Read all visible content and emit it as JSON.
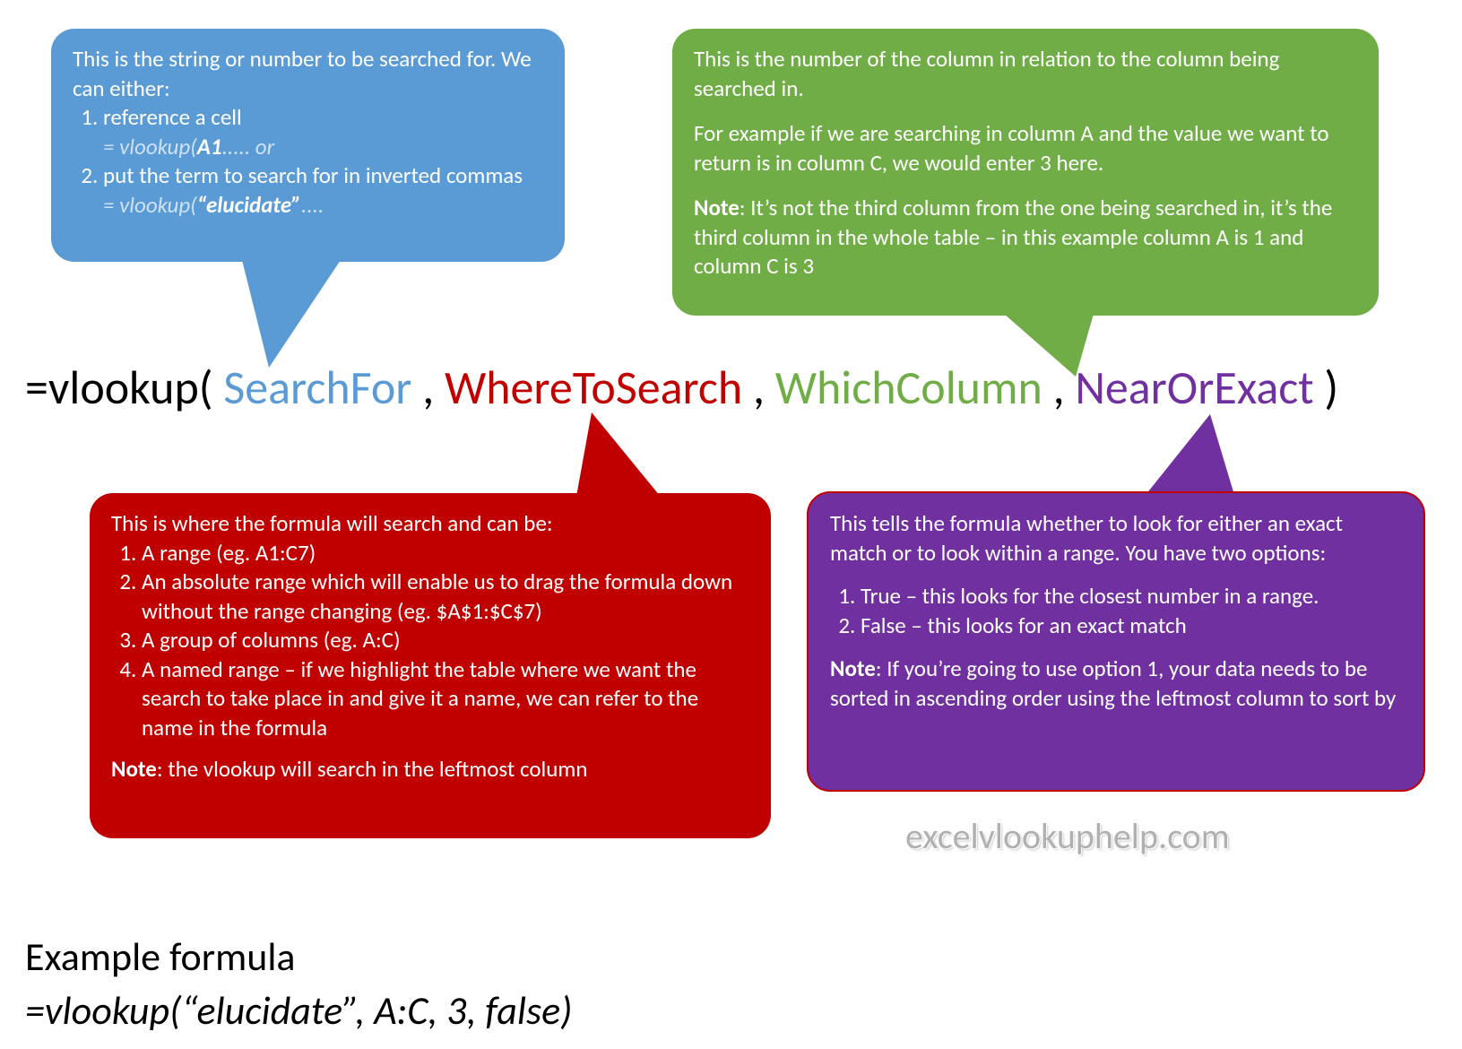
{
  "formula": {
    "prefix": "=vlookup(",
    "arg1": "SearchFor",
    "arg2": "WhereToSearch",
    "arg3": "WhichColumn",
    "arg4": "NearOrExact",
    "sep1": ",",
    "sep2": ",",
    "sep3": ",",
    "suffix": ")"
  },
  "callouts": {
    "searchFor": {
      "intro": "This is the string or number to be searched for. We can either:",
      "opt1": "reference a cell",
      "opt1_code_pre": "= vlookup(",
      "opt1_code_em": "A1",
      "opt1_code_post": "..... or",
      "opt2": "put the term to search for in inverted commas",
      "opt2_code_pre": "= vlookup(",
      "opt2_code_em": "“elucidate”",
      "opt2_code_post": "...."
    },
    "whichColumn": {
      "p1": "This is the number of the column in relation to the column being searched in.",
      "p2": "For example if we are searching in column A and the value we want to return is in column C, we would enter 3 here.",
      "note_label": "Note",
      "note": ": It’s not the third column from the one being searched in, it’s the third column in the whole table – in this example column A is 1 and column C is 3"
    },
    "whereToSearch": {
      "intro": "This is where the formula will search and can be:",
      "o1": "A range (eg. A1:C7)",
      "o2": "An absolute range which will enable us to drag the formula down without the range changing (eg. $A$1:$C$7)",
      "o3": "A group of columns (eg. A:C)",
      "o4": "A named range – if we highlight the table where we want the search to take place in and give it a name, we can refer to the name in the formula",
      "note_label": "Note",
      "note": ": the vlookup will search in the leftmost column"
    },
    "nearOrExact": {
      "intro": "This tells the formula whether to look for either an exact match or to look within a range. You have two options:",
      "o1": "True – this looks for the closest number in a range.",
      "o2": "False – this looks for an exact match",
      "note_label": "Note",
      "note": ": If you’re going to use option 1, your data needs to be sorted in ascending order using the leftmost column to sort by"
    }
  },
  "watermark": "excelvlookuphelp.com",
  "example": {
    "title": "Example formula",
    "formula": "=vlookup(“elucidate”, A:C, 3, false)"
  }
}
